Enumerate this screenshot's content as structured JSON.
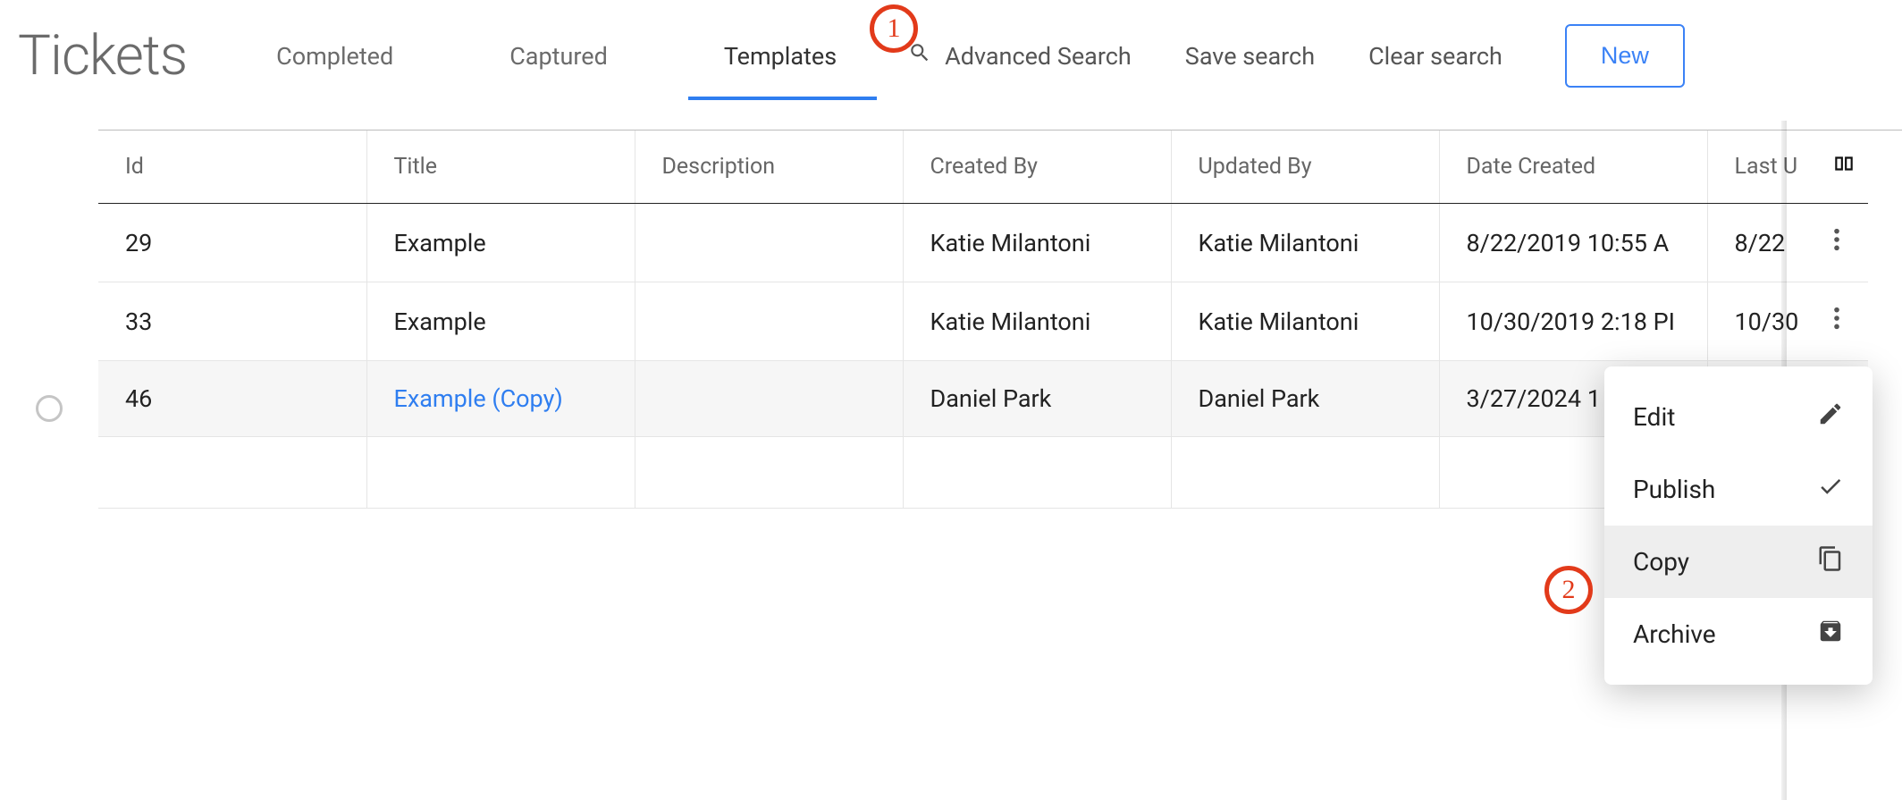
{
  "header": {
    "title": "Tickets",
    "tabs": [
      "Completed",
      "Captured",
      "Templates"
    ],
    "active_tab_index": 2,
    "advanced_search": "Advanced Search",
    "save_search": "Save search",
    "clear_search": "Clear search",
    "new_button": "New"
  },
  "annotations": {
    "a1": "1",
    "a2": "2"
  },
  "table": {
    "columns": [
      "Id",
      "Title",
      "Description",
      "Created By",
      "Updated By",
      "Date Created",
      "Last U"
    ],
    "rows": [
      {
        "id": "29",
        "title": "Example",
        "title_link": false,
        "description": "",
        "created_by": "Katie Milantoni",
        "updated_by": "Katie Milantoni",
        "date_created": "8/22/2019 10:55 A",
        "last_updated": "8/22"
      },
      {
        "id": "33",
        "title": "Example",
        "title_link": false,
        "description": "",
        "created_by": "Katie Milantoni",
        "updated_by": "Katie Milantoni",
        "date_created": "10/30/2019 2:18 PI",
        "last_updated": "10/30"
      },
      {
        "id": "46",
        "title": "Example (Copy)",
        "title_link": true,
        "description": "",
        "created_by": "Daniel Park",
        "updated_by": "Daniel Park",
        "date_created": "3/27/2024 1",
        "last_updated": ""
      }
    ]
  },
  "context_menu": {
    "items": [
      {
        "label": "Edit",
        "icon": "pencil"
      },
      {
        "label": "Publish",
        "icon": "check"
      },
      {
        "label": "Copy",
        "icon": "copy"
      },
      {
        "label": "Archive",
        "icon": "archive"
      }
    ],
    "hover_index": 2
  }
}
